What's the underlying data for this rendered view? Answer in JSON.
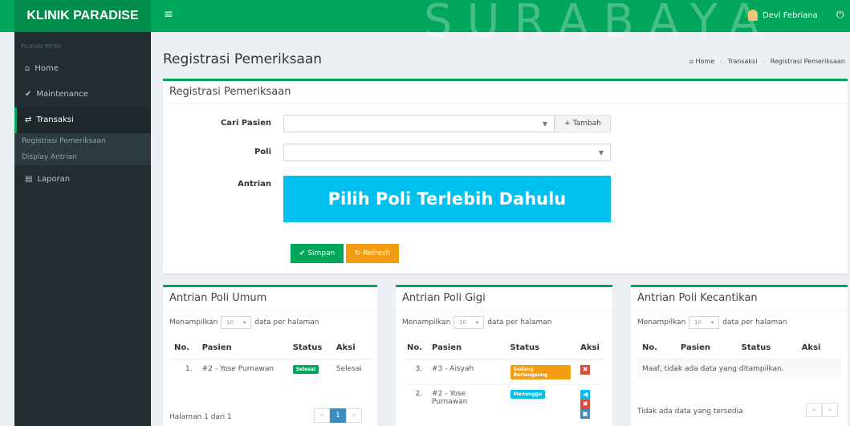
{
  "app": {
    "brand": "KLINIK PARADISE",
    "watermark": "SURABAYA",
    "user": "Devi Febriana"
  },
  "sidebar": {
    "header": "PILIHAN MENU",
    "items": [
      {
        "label": "Home",
        "icon": "home-icon"
      },
      {
        "label": "Maintenance",
        "icon": "check-icon"
      },
      {
        "label": "Transaksi",
        "icon": "exchange-icon"
      },
      {
        "label": "Laporan",
        "icon": "file-icon"
      }
    ],
    "subitems": [
      "Registrasi Pemeriksaan",
      "Display Antrian"
    ]
  },
  "page": {
    "title": "Registrasi Pemeriksaan",
    "breadcrumb": [
      "Home",
      "Transaksi",
      "Registrasi Pemeriksaan"
    ]
  },
  "form": {
    "title": "Registrasi Pemeriksaan",
    "cari_label": "Cari Pasien",
    "tambah_label": "Tambah",
    "poli_label": "Poli",
    "antrian_label": "Antrian",
    "antrian_text": "Pilih Poli Terlebih Dahulu",
    "simpan_label": "Simpan",
    "refresh_label": "Refresh"
  },
  "panels": {
    "umum": {
      "title": "Antrian Poli Umum",
      "show_prefix": "Menampilkan",
      "show_value": "10",
      "show_suffix": "data per halaman",
      "headers": [
        "No.",
        "Pasien",
        "Status",
        "Aksi"
      ],
      "rows": [
        {
          "no": "1.",
          "pasien": "#2 - Yose Purnawan",
          "status": "Selesai",
          "aksi": "Selesai"
        }
      ],
      "footer": "Halaman 1 dari 1",
      "page": "1"
    },
    "gigi": {
      "title": "Antrian Poli Gigi",
      "show_prefix": "Menampilkan",
      "show_value": "10",
      "show_suffix": "data per halaman",
      "headers": [
        "No.",
        "Pasien",
        "Status",
        "Aksi"
      ],
      "rows": [
        {
          "no": "3.",
          "pasien": "#3 - Aisyah",
          "status": "Sedang Berlangsung"
        },
        {
          "no": "2.",
          "pasien": "#2 - Yose Purnawan",
          "status": "Menunggu"
        }
      ]
    },
    "kecantikan": {
      "title": "Antrian Poli Kecantikan",
      "show_prefix": "Menampilkan",
      "show_value": "10",
      "show_suffix": "data per halaman",
      "headers": [
        "No.",
        "Pasien",
        "Status",
        "Aksi"
      ],
      "empty": "Maaf, tidak ada data yang ditampilkan.",
      "footer": "Tidak ada data yang tersedia"
    }
  },
  "colors": {
    "green": "#00a65a",
    "dark": "#222d32",
    "aqua": "#00c0ef",
    "orange": "#f39c12",
    "red": "#dd4b39",
    "blue": "#3c8dbc"
  }
}
